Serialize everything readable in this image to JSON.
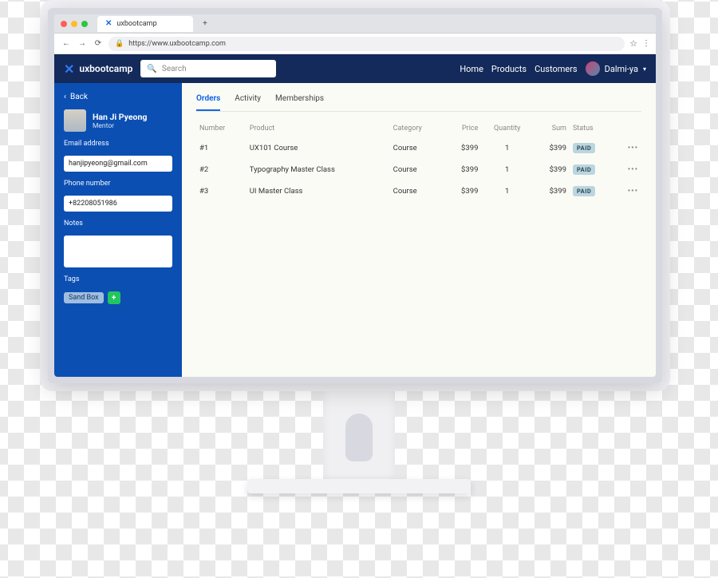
{
  "browser": {
    "tab_title": "uxbootcamp",
    "url": "https://www.uxbootcamp.com"
  },
  "topnav": {
    "brand": "uxbootcamp",
    "search_placeholder": "Search",
    "links": [
      "Home",
      "Products",
      "Customers"
    ],
    "user_name": "Dalmi-ya"
  },
  "sidebar": {
    "back": "Back",
    "customer": {
      "name": "Han Ji Pyeong",
      "role": "Mentor"
    },
    "fields": {
      "email_label": "Email address",
      "email_value": "hanjipyeong@gmail.com",
      "phone_label": "Phone number",
      "phone_value": "+82208051986",
      "notes_label": "Notes",
      "notes_value": "",
      "tags_label": "Tags"
    },
    "tags": [
      "Sand Box"
    ]
  },
  "main": {
    "tabs": [
      "Orders",
      "Activity",
      "Memberships"
    ],
    "active_tab": 0,
    "columns": {
      "number": "Number",
      "product": "Product",
      "category": "Category",
      "price": "Price",
      "quantity": "Quantity",
      "sum": "Sum",
      "status": "Status"
    },
    "rows": [
      {
        "number": "#1",
        "product": "UX101 Course",
        "category": "Course",
        "price": "$399",
        "quantity": "1",
        "sum": "$399",
        "status": "PAID"
      },
      {
        "number": "#2",
        "product": "Typography Master Class",
        "category": "Course",
        "price": "$399",
        "quantity": "1",
        "sum": "$399",
        "status": "PAID"
      },
      {
        "number": "#3",
        "product": "UI Master Class",
        "category": "Course",
        "price": "$399",
        "quantity": "1",
        "sum": "$399",
        "status": "PAID"
      }
    ]
  }
}
